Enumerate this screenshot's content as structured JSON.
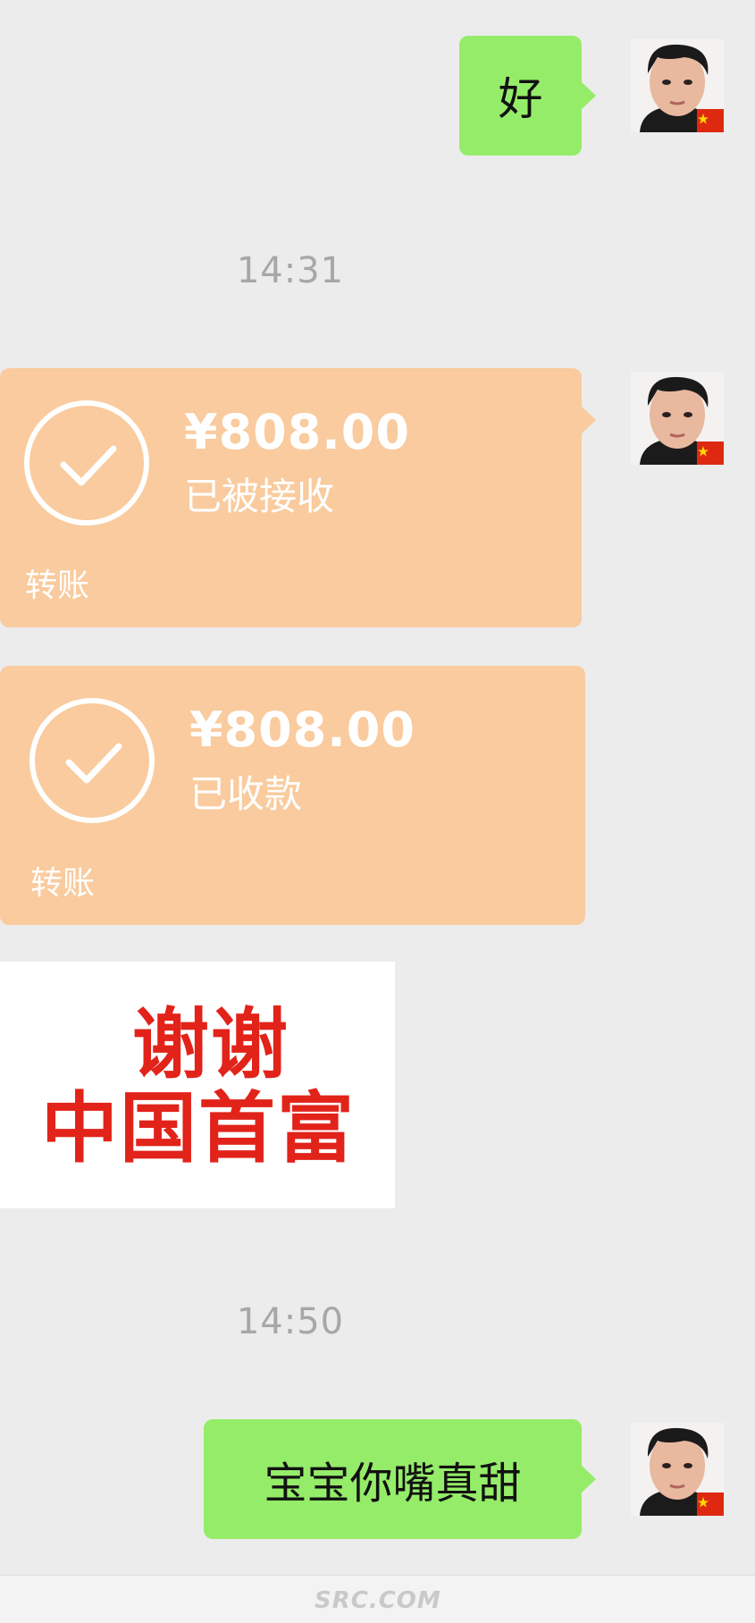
{
  "messages": {
    "msg1_text": "好",
    "time1": "14:31",
    "transfer1": {
      "amount": "¥808.00",
      "status": "已被接收",
      "label": "转账"
    },
    "transfer2": {
      "amount": "¥808.00",
      "status": "已收款",
      "label": "转账"
    },
    "sticker": {
      "line1": "谢谢",
      "line2": "中国首富"
    },
    "time2": "14:50",
    "msg2_text": "宝宝你嘴真甜"
  },
  "footer": {
    "watermark": "SRC.COM"
  },
  "colors": {
    "background": "#ececec",
    "sent_bubble": "#95ec69",
    "transfer_card": "#f9cb9e",
    "sticker_text": "#e2231a",
    "timestamp": "#a7a7a7"
  },
  "icons": {
    "avatar": "user-avatar-with-china-flag-icon",
    "transfer_check": "check-circle-icon"
  }
}
